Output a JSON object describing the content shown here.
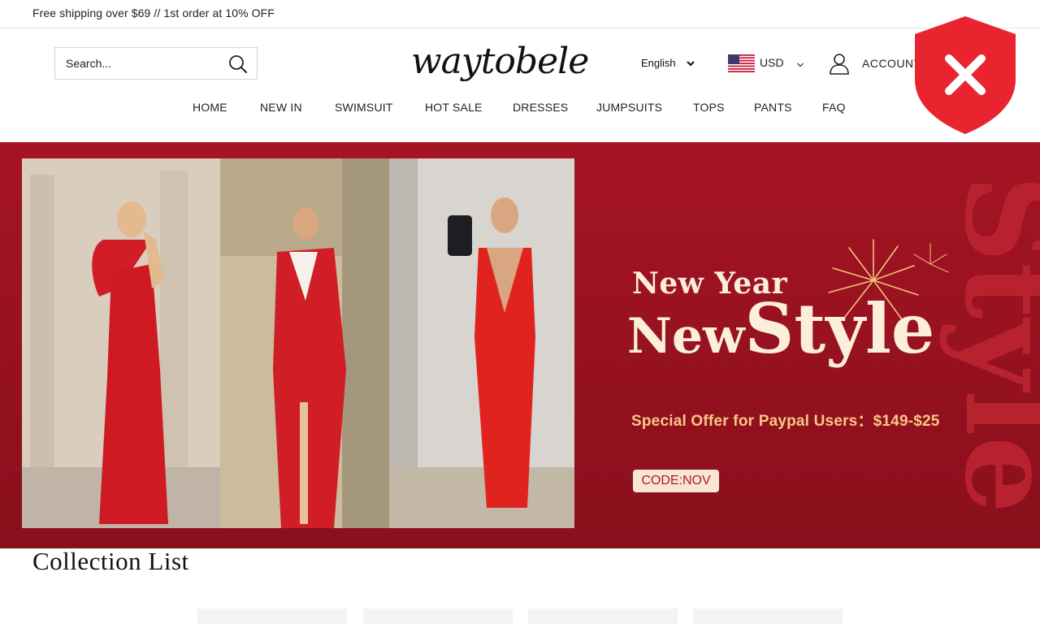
{
  "announcement": {
    "text": "Free shipping over $69 // 1st order at 10% OFF"
  },
  "header": {
    "search_placeholder": "Search...",
    "logo_text": "waytobele",
    "language": "English",
    "currency": "USD",
    "account_label": "ACCOUNT"
  },
  "nav": {
    "items": [
      "HOME",
      "NEW IN",
      "SWIMSUIT",
      "HOT SALE",
      "DRESSES",
      "JUMPSUITS",
      "TOPS",
      "PANTS",
      "FAQ"
    ]
  },
  "banner": {
    "headline_line1": "New Year",
    "headline_new": "New",
    "headline_style": "Style",
    "offer": "Special Offer for Paypal Users：$149-$25",
    "code": "CODE:NOV"
  },
  "collection": {
    "title": "Collection List"
  },
  "colors": {
    "banner_red": "#a51424",
    "banner_text": "#fbeedb",
    "offer_text": "#f6c985",
    "shield_red": "#e8252f"
  },
  "icons": [
    "search-icon",
    "chevron-down-icon",
    "us-flag-icon",
    "user-icon",
    "close-icon"
  ]
}
